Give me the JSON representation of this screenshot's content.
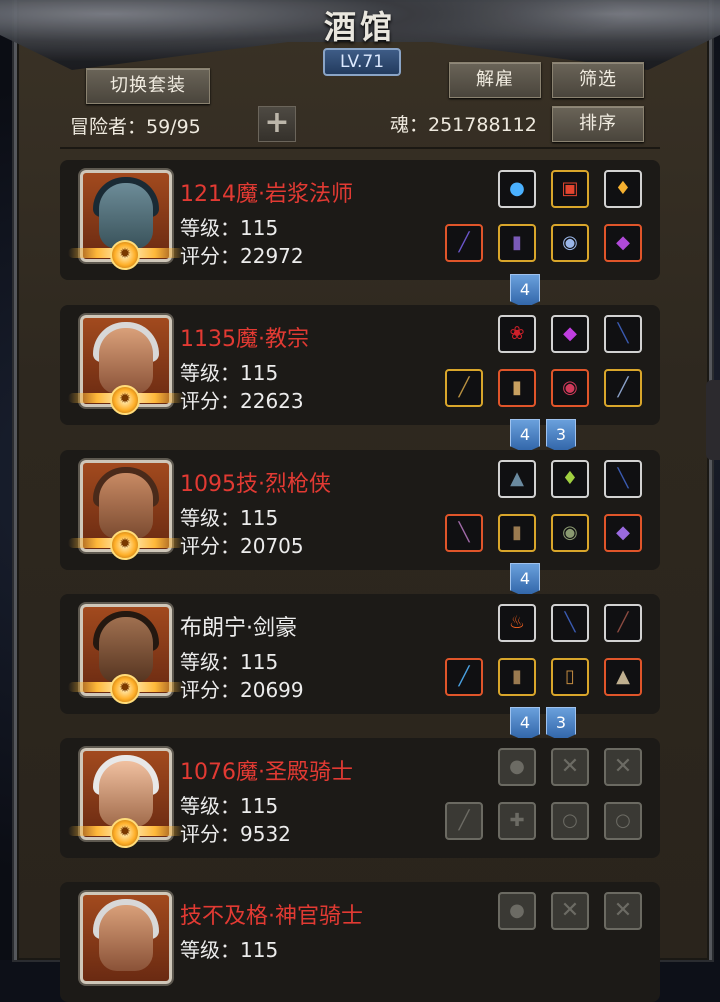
{
  "header": {
    "title": "酒馆",
    "level": "LV.71",
    "switch_outfit_label": "切换套装",
    "dismiss_label": "解雇",
    "filter_label": "筛选",
    "sort_label": "排序",
    "adventurers_text": "冒险者：59/95",
    "soul_text": "魂：251788112",
    "plus_symbol": "+"
  },
  "heroes": [
    {
      "name": "1214魔·岩浆法师",
      "level": "等级：115",
      "score": "评分：22972",
      "name_color": "red"
    },
    {
      "name": "1135魔·教宗",
      "level": "等级：115",
      "score": "评分：22623",
      "name_color": "red"
    },
    {
      "name": "1095技·烈枪侠",
      "level": "等级：115",
      "score": "评分：20705",
      "name_color": "red"
    },
    {
      "name": "布朗宁·剑豪",
      "level": "等级：115",
      "score": "评分：20699",
      "name_color": "white"
    },
    {
      "name": "1076魔·圣殿骑士",
      "level": "等级：115",
      "score": "评分：9532",
      "name_color": "red"
    },
    {
      "name": "技不及格·神官骑士",
      "level": "等级：115",
      "name_color": "red"
    }
  ],
  "gem_tags": {
    "row1": [
      "4"
    ],
    "row2": [
      "4",
      "3"
    ],
    "row3": [
      "4"
    ],
    "row4": [
      "4",
      "3"
    ]
  },
  "icons": {
    "equipment": [
      "orb-icon",
      "demon-mask-icon",
      "lantern-icon",
      "staff-icon",
      "robe-icon",
      "amulet-icon",
      "scroll-icon",
      "bow-icon",
      "gem-icon",
      "sword-icon",
      "shield-icon",
      "armor-icon",
      "flame-icon",
      "helmet-icon"
    ],
    "empty_slot_glyph": "✕",
    "sun_glyph": "✹"
  },
  "colors": {
    "hero_name_red": "#e23a33",
    "hero_name_white": "#ececec",
    "gem_tag_blue": "#3f78c0"
  }
}
